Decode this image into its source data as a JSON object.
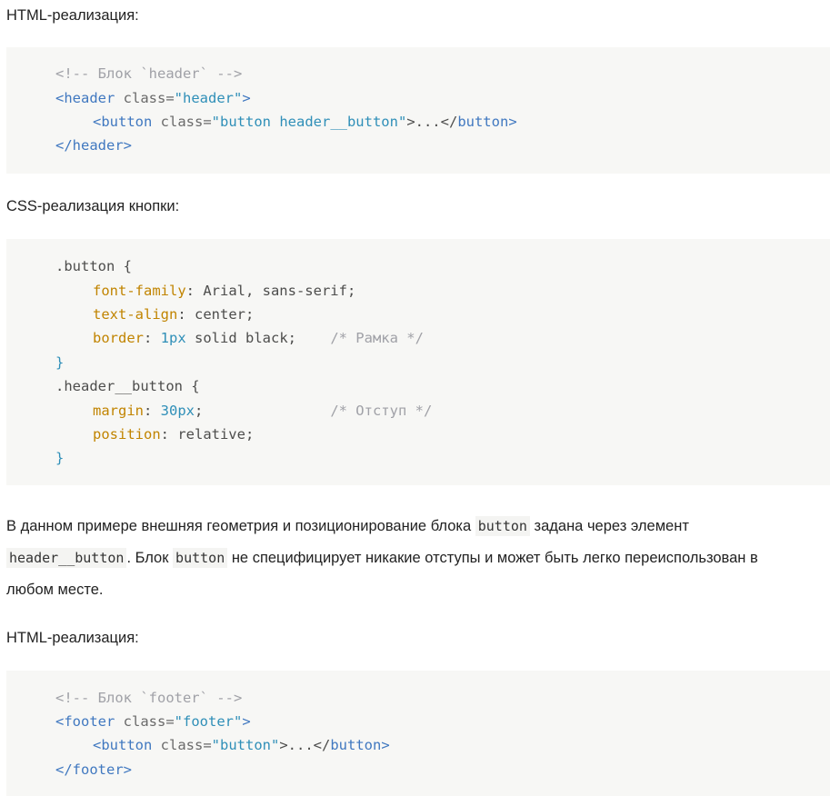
{
  "headings": {
    "html1": "HTML-реализация:",
    "css1": "CSS-реализация кнопки:",
    "html2": "HTML-реализация:"
  },
  "code_html1": {
    "l1_comment": "<!-- Блок `header` -->",
    "l2_open": "<",
    "l2_tag": "header",
    "l2_attr": " class=",
    "l2_val": "\"header\"",
    "l2_close": ">",
    "l3_open": "<",
    "l3_tag": "button",
    "l3_attr": " class=",
    "l3_val": "\"button header__button\"",
    "l3_mid": ">...</",
    "l3_tag2": "button",
    "l3_close": ">",
    "l4_open": "</",
    "l4_tag": "header",
    "l4_close": ">"
  },
  "code_css": {
    "l1": ".button {",
    "l2_prop": "font-family",
    "l2_val": ": Arial, sans-serif;",
    "l3_prop": "text-align",
    "l3_val": ": center;",
    "l4_prop": "border",
    "l4_sep": ": ",
    "l4_num": "1px",
    "l4_rest": " solid black;    ",
    "l4_comment": "/* Рамка */",
    "l5": "}",
    "l6": ".header__button {",
    "l7_prop": "margin",
    "l7_sep": ": ",
    "l7_num": "30px",
    "l7_rest": ";               ",
    "l7_comment": "/* Отступ */",
    "l8_prop": "position",
    "l8_val": ": relative;",
    "l9": "}"
  },
  "prose": {
    "p1_a": "В данном примере внешняя геометрия и позиционирование блока ",
    "p1_code": "button",
    "p1_b": " задана через элемент",
    "p2_code": "header__button",
    "p2_a": ". Блок ",
    "p2_code2": "button",
    "p2_b": " не специфицирует никакие отступы и может быть легко переиспользован в",
    "p3": "любом месте."
  },
  "code_html2": {
    "l1_comment": "<!-- Блок `footer` -->",
    "l2_open": "<",
    "l2_tag": "footer",
    "l2_attr": " class=",
    "l2_val": "\"footer\"",
    "l2_close": ">",
    "l3_open": "<",
    "l3_tag": "button",
    "l3_attr": " class=",
    "l3_val": "\"button\"",
    "l3_mid": ">...</",
    "l3_tag2": "button",
    "l3_close": ">",
    "l4_open": "</",
    "l4_tag": "footer",
    "l4_close": ">"
  }
}
